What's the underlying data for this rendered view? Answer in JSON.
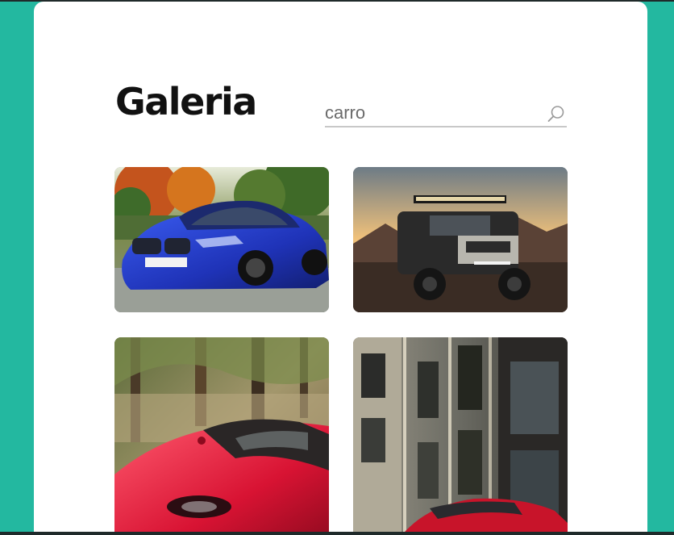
{
  "page": {
    "title": "Galeria"
  },
  "search": {
    "value": "carro",
    "placeholder": "carro",
    "icon": "search-icon"
  },
  "gallery": {
    "items": [
      {
        "name": "blue-sedan-photo",
        "alt": ""
      },
      {
        "name": "offroad-truck-photo",
        "alt": ""
      },
      {
        "name": "red-sports-car-forest-photo",
        "alt": ""
      },
      {
        "name": "red-car-city-street-photo",
        "alt": ""
      }
    ]
  },
  "colors": {
    "background": "#23b8a0",
    "card": "#ffffff",
    "title": "#111111",
    "search_text": "#6b6b6b"
  }
}
